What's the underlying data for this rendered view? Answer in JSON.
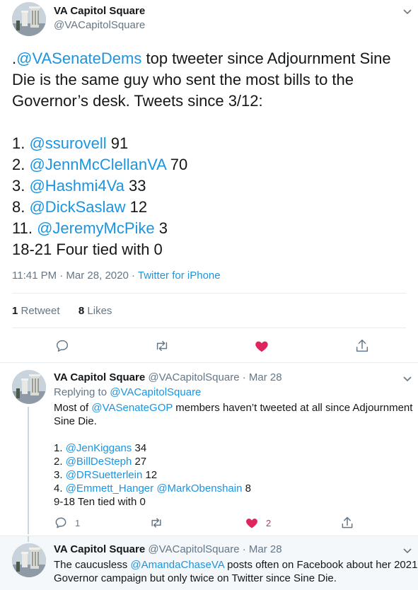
{
  "main": {
    "name": "VA Capitol Square",
    "handle": "@VACapitolSquare",
    "text_lines": [
      [
        {
          "t": ".",
          "link": false
        },
        {
          "t": "@VASenateDems",
          "link": true
        },
        {
          "t": " top tweeter since Adjournment Sine",
          "link": false
        }
      ],
      [
        {
          "t": "Die is the same guy who sent the most bills to the",
          "link": false
        }
      ],
      [
        {
          "t": "Governor’s desk. Tweets since 3/12:",
          "link": false
        }
      ],
      [
        {
          "t": "",
          "link": false
        }
      ],
      [
        {
          "t": "1. ",
          "link": false
        },
        {
          "t": "@ssurovell",
          "link": true
        },
        {
          "t": " 91",
          "link": false
        }
      ],
      [
        {
          "t": "2. ",
          "link": false
        },
        {
          "t": "@JennMcClellanVA",
          "link": true
        },
        {
          "t": " 70",
          "link": false
        }
      ],
      [
        {
          "t": "3. ",
          "link": false
        },
        {
          "t": "@Hashmi4Va",
          "link": true
        },
        {
          "t": " 33",
          "link": false
        }
      ],
      [
        {
          "t": "8. ",
          "link": false
        },
        {
          "t": "@DickSaslaw",
          "link": true
        },
        {
          "t": " 12",
          "link": false
        }
      ],
      [
        {
          "t": "11. ",
          "link": false
        },
        {
          "t": "@JeremyMcPike",
          "link": true
        },
        {
          "t": " 3",
          "link": false
        }
      ],
      [
        {
          "t": "18-21 Four tied with 0",
          "link": false
        }
      ]
    ],
    "timestamp": "11:41 PM · Mar 28, 2020 · ",
    "source": "Twitter for iPhone",
    "retweets_count": "1",
    "retweets_label": " Retweet",
    "likes_count": "8",
    "likes_label": " Likes",
    "liked": true,
    "colors": {
      "link": "#1b95e0",
      "like": "#e0245e",
      "muted": "#657786"
    }
  },
  "replies": [
    {
      "name": "VA Capitol Square",
      "handle": "@VACapitolSquare",
      "date": " · Mar 28",
      "replying_prefix": "Replying to ",
      "replying_to": "@VACapitolSquare",
      "body_lines": [
        [
          {
            "t": "Most of ",
            "link": false
          },
          {
            "t": "@VASenateGOP",
            "link": true
          },
          {
            "t": " members haven’t tweeted at all since Adjournment",
            "link": false
          }
        ],
        [
          {
            "t": "Sine Die.",
            "link": false
          }
        ],
        [
          {
            "t": "",
            "link": false
          }
        ],
        [
          {
            "t": "1. ",
            "link": false
          },
          {
            "t": "@JenKiggans",
            "link": true
          },
          {
            "t": " 34",
            "link": false
          }
        ],
        [
          {
            "t": "2. ",
            "link": false
          },
          {
            "t": "@BillDeSteph",
            "link": true
          },
          {
            "t": " 27",
            "link": false
          }
        ],
        [
          {
            "t": "3. ",
            "link": false
          },
          {
            "t": "@DRSuetterlein",
            "link": true
          },
          {
            "t": " 12",
            "link": false
          }
        ],
        [
          {
            "t": "4. ",
            "link": false
          },
          {
            "t": "@Emmett_Hanger",
            "link": true
          },
          {
            "t": " ",
            "link": false
          },
          {
            "t": "@MarkObenshain",
            "link": true
          },
          {
            "t": " 8",
            "link": false
          }
        ],
        [
          {
            "t": "9-18 Ten tied with 0",
            "link": false
          }
        ]
      ],
      "reply_count": "1",
      "like_count": "2"
    },
    {
      "name": "VA Capitol Square",
      "handle": "@VACapitolSquare",
      "date": " · Mar 28",
      "body_lines": [
        [
          {
            "t": "The caucusless ",
            "link": false
          },
          {
            "t": "@AmandaChaseVA",
            "link": true
          },
          {
            "t": " posts often on Facebook about her 2021",
            "link": false
          }
        ],
        [
          {
            "t": "Governor campaign but only twice on Twitter since Sine Die.",
            "link": false
          }
        ]
      ]
    }
  ],
  "icons": [
    "chevron-down-icon",
    "reply-icon",
    "retweet-icon",
    "heart-icon",
    "share-icon"
  ]
}
